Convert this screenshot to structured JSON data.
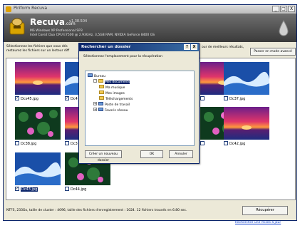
{
  "app": {
    "title": "Piriform Recuva",
    "brand": "Recuva",
    "brand_suffix": ".com",
    "version": "v1.38.504",
    "sysinfo": [
      "MS Windows XP Professional SP3",
      "Intel Core2 Duo CPU E7500 @ 2.93GHz, 3,5GB RAM, NVIDIA GeForce 8400 GS"
    ]
  },
  "window_buttons": [
    "_",
    "□",
    "X"
  ],
  "instructions": {
    "left_line1": "Sélectionnez les fichiers que vous dés",
    "left_line2": "restaurez les fichiers sur un lecteur diff",
    "right": "our de meilleurs résultats,",
    "advanced_button": "Passer en mode avancé"
  },
  "files": [
    {
      "name": "Dcs45.jpg",
      "checked": true,
      "selected": false,
      "img": "sunset"
    },
    {
      "name": "Dc4",
      "checked": true,
      "selected": false,
      "img": "wave"
    },
    {
      "name": "",
      "checked": false,
      "selected": false,
      "img": "sunset"
    },
    {
      "name": "Dc37.jpg",
      "checked": false,
      "selected": false,
      "img": "wave"
    },
    {
      "name": "Dc38.jpg",
      "checked": false,
      "selected": false,
      "img": "lily"
    },
    {
      "name": "Dc3",
      "checked": false,
      "selected": false,
      "img": "sunset"
    },
    {
      "name": "",
      "checked": false,
      "selected": false,
      "img": "lily"
    },
    {
      "name": "Dc42.jpg",
      "checked": false,
      "selected": false,
      "img": "sunset"
    },
    {
      "name": "Dc43.jpg",
      "checked": true,
      "selected": true,
      "img": "wave"
    },
    {
      "name": "Dc44.jpg",
      "checked": false,
      "selected": false,
      "img": "lily"
    }
  ],
  "status": "NTFS, 233Go, taille de cluster : 4096, taille des fichiers d'enregistrement : 1024. 12 fichiers trouvés en 6.80 sec.",
  "recover_button": "Récupérer",
  "update_link": "Rechercher une mises à jour",
  "dialog": {
    "title": "Rechercher un dossier",
    "buttons_title": [
      "?",
      "X"
    ],
    "prompt": "Sélectionnez l'emplacement pour la récupération",
    "tree": [
      {
        "label": "Bureau",
        "level": 0,
        "expander": "",
        "selected": false,
        "icon": "desktop-icon"
      },
      {
        "label": "Mes documents",
        "level": 1,
        "expander": "-",
        "selected": true,
        "icon": "folder-icon"
      },
      {
        "label": "Ma musique",
        "level": 2,
        "expander": "",
        "selected": false,
        "icon": "folder-icon"
      },
      {
        "label": "Mes images",
        "level": 2,
        "expander": "",
        "selected": false,
        "icon": "folder-icon"
      },
      {
        "label": "Téléchargements",
        "level": 2,
        "expander": "",
        "selected": false,
        "icon": "folder-icon"
      },
      {
        "label": "Poste de travail",
        "level": 1,
        "expander": "+",
        "selected": false,
        "icon": "computer-icon"
      },
      {
        "label": "Favoris réseau",
        "level": 1,
        "expander": "+",
        "selected": false,
        "icon": "network-icon"
      }
    ],
    "new_folder": "Créer un nouveau dossier",
    "ok": "OK",
    "cancel": "Annuler"
  }
}
